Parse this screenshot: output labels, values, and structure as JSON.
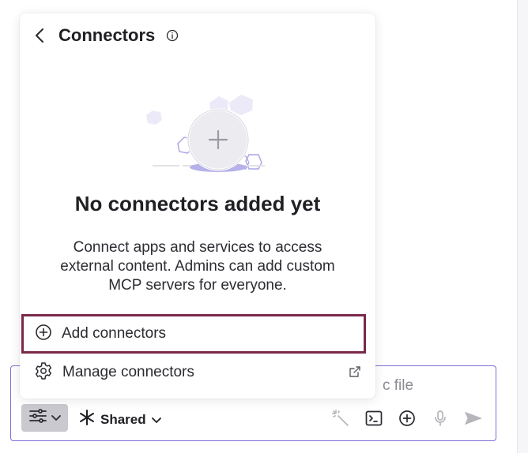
{
  "popup": {
    "title": "Connectors",
    "empty_state": {
      "title": "No connectors added yet",
      "description": "Connect apps and services to access external content. Admins can add custom MCP servers for everyone."
    },
    "menu": {
      "add_label": "Add connectors",
      "manage_label": "Manage connectors"
    }
  },
  "composer": {
    "placeholder_fragment": "c file",
    "visibility_label": "Shared"
  },
  "colors": {
    "focus_outline": "#7a2849",
    "composer_border": "#7b6fd6",
    "illustration": "#a9a3e6"
  }
}
